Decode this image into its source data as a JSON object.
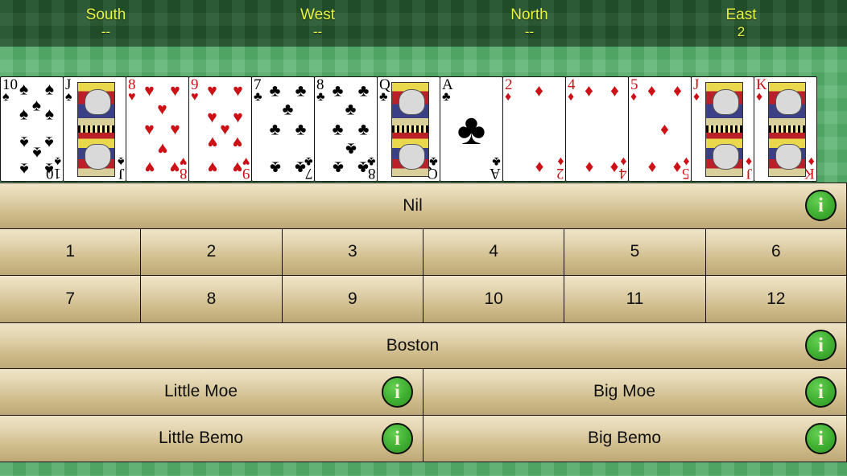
{
  "header": {
    "seats": [
      {
        "name": "South",
        "bid": "--"
      },
      {
        "name": "West",
        "bid": "--"
      },
      {
        "name": "North",
        "bid": "--"
      },
      {
        "name": "East",
        "bid": "2"
      }
    ]
  },
  "hand": {
    "cards": [
      {
        "rank": "10",
        "suit": "spades",
        "symbol": "♠",
        "color": "black",
        "kind": "pip",
        "count": 10
      },
      {
        "rank": "J",
        "suit": "spades",
        "symbol": "♠",
        "color": "black",
        "kind": "court",
        "count": 0
      },
      {
        "rank": "8",
        "suit": "hearts",
        "symbol": "♥",
        "color": "red",
        "kind": "pip",
        "count": 8
      },
      {
        "rank": "9",
        "suit": "hearts",
        "symbol": "♥",
        "color": "red",
        "kind": "pip",
        "count": 9
      },
      {
        "rank": "7",
        "suit": "clubs",
        "symbol": "♣",
        "color": "black",
        "kind": "pip",
        "count": 7
      },
      {
        "rank": "8",
        "suit": "clubs",
        "symbol": "♣",
        "color": "black",
        "kind": "pip",
        "count": 8
      },
      {
        "rank": "Q",
        "suit": "clubs",
        "symbol": "♣",
        "color": "black",
        "kind": "court",
        "count": 0
      },
      {
        "rank": "A",
        "suit": "clubs",
        "symbol": "♣",
        "color": "black",
        "kind": "ace",
        "count": 1
      },
      {
        "rank": "2",
        "suit": "diamonds",
        "symbol": "♦",
        "color": "red",
        "kind": "pip",
        "count": 2
      },
      {
        "rank": "4",
        "suit": "diamonds",
        "symbol": "♦",
        "color": "red",
        "kind": "pip",
        "count": 4
      },
      {
        "rank": "5",
        "suit": "diamonds",
        "symbol": "♦",
        "color": "red",
        "kind": "pip",
        "count": 5
      },
      {
        "rank": "J",
        "suit": "diamonds",
        "symbol": "♦",
        "color": "red",
        "kind": "court",
        "count": 0
      },
      {
        "rank": "K",
        "suit": "diamonds",
        "symbol": "♦",
        "color": "red",
        "kind": "court",
        "count": 0
      }
    ]
  },
  "bids": {
    "nil_label": "Nil",
    "numbers_row1": [
      "1",
      "2",
      "3",
      "4",
      "5",
      "6"
    ],
    "numbers_row2": [
      "7",
      "8",
      "9",
      "10",
      "11",
      "12"
    ],
    "boston_label": "Boston",
    "little_moe_label": "Little Moe",
    "big_moe_label": "Big Moe",
    "little_bemo_label": "Little Bemo",
    "big_bemo_label": "Big Bemo",
    "info_glyph": "i",
    "info_icon_name": "info-icon"
  },
  "colors": {
    "felt_light": "#56b06b",
    "felt_dark": "#25562f",
    "seat_text": "#e8f442",
    "button_top": "#efe4c6",
    "button_bottom": "#bda778",
    "info_green": "#3fae31",
    "card_red": "#cc1117",
    "card_black": "#000000"
  }
}
